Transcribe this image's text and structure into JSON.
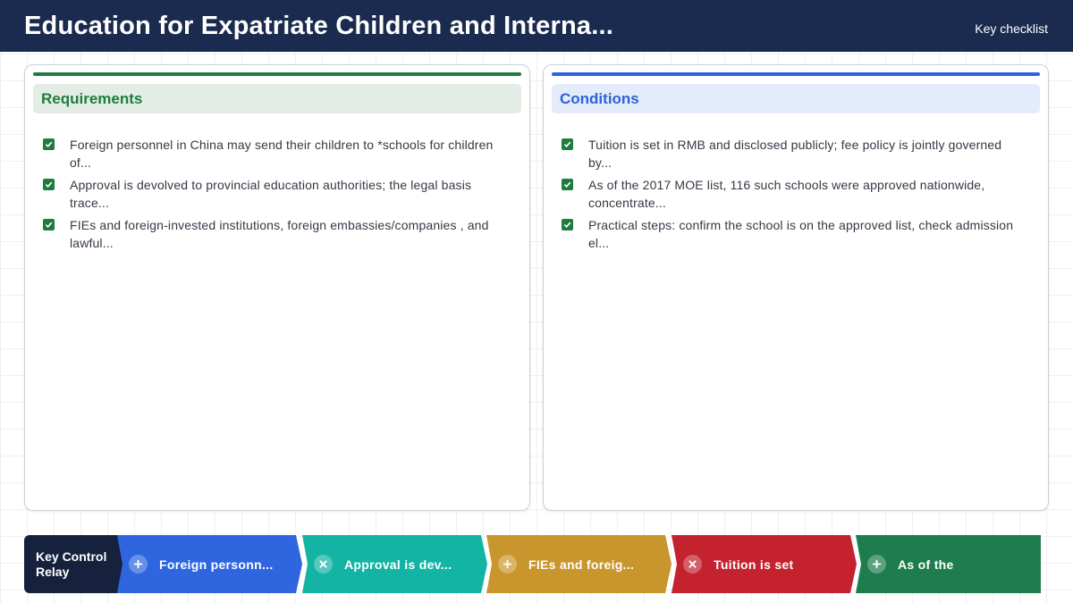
{
  "header": {
    "title": "Education for Expatriate Children and Interna...",
    "tag": "Key checklist"
  },
  "panels": [
    {
      "heading": "Requirements",
      "accent": "#1e7d3e",
      "items": [
        {
          "text": "Foreign personnel in China may send their children to *schools for children of..."
        },
        {
          "text": "Approval is devolved to provincial education authorities; the legal basis trace..."
        },
        {
          "text": "FIEs and foreign-invested institutions, foreign embassies/companies , and lawful..."
        }
      ]
    },
    {
      "heading": "Conditions",
      "accent": "#2d62d8",
      "items": [
        {
          "text": "Tuition is set in RMB and disclosed publicly; fee policy is jointly governed by..."
        },
        {
          "text": "As of the 2017 MOE list, 116 such schools were approved nationwide, concentrate..."
        },
        {
          "text": "Practical steps: confirm the school is on the approved list, check admission el..."
        }
      ]
    }
  ],
  "relay": {
    "label": "Key Control Relay",
    "chips": [
      {
        "text": "Foreign personn...",
        "icon": "plus-icon",
        "color": "#2f66e0"
      },
      {
        "text": "Approval is dev...",
        "icon": "close-icon",
        "color": "#14b4a4"
      },
      {
        "text": "FIEs and foreig...",
        "icon": "plus-icon",
        "color": "#c9962e"
      },
      {
        "text": "Tuition is set",
        "icon": "close-icon",
        "color": "#c4222f"
      },
      {
        "text": "As of the",
        "icon": "plus-icon",
        "color": "#1e7d4c"
      }
    ]
  }
}
